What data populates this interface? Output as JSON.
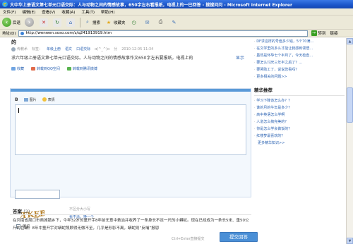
{
  "window": {
    "title": "大中华上册语文第七单元口语交际：人与动物之间的情感故事，650字左右看报纸，电视上的一已回答 - 搜搜问问 - Microsoft Internet Explorer"
  },
  "menu": [
    "文件(F)",
    "编辑(E)",
    "查看(V)",
    "收藏(A)",
    "工具(T)",
    "帮助(H)"
  ],
  "toolbar": {
    "back": "后退",
    "search": "搜索",
    "favorites": "收藏夹"
  },
  "address": {
    "label": "地址(D)",
    "url": "http://wenwen.soso.com/z/q241913919.htm",
    "go": "转到",
    "links": "链接"
  },
  "question": {
    "title": "的",
    "asker": "传教术",
    "tags_prefix": "标签：",
    "tags": [
      "年级上册",
      "语文",
      "口语交际"
    ],
    "level": "ɑ(^_^)ɑ",
    "score": "分",
    "date": "2010-12-05 11:34",
    "body": "求六年级上册语文第七单元口语交际。人与动物之间的情感故事作文650字左右要报纸，电视上的",
    "more": "显示",
    "actions": [
      "收藏",
      "转载到QQ空间",
      "转载到腾讯微博"
    ]
  },
  "editor": {
    "bold": "B",
    "picture": "图片",
    "emoticon": "表情",
    "captcha_text": "TKEB",
    "captcha_hint": "不区分大小写",
    "captcha_refresh": "看不清，换一个",
    "anonymous": "匿名",
    "submit_hint": "Ctrl+Enter直接提交",
    "submit": "提交回答"
  },
  "answers": {
    "label": "答案",
    "count": "(2)",
    "text": "在河南省周口市商城镇乡下，今年32岁的童开宇8年前无意中救治并收养了一条身长不足一尺的小蟒蛇。现在已经成为一条长5米、重50公斤的巨蟒。8年中童开宇对蟒蛇照顾得无微不至，几乎是形影不离，蟒蛇则“反哺”报恩"
  },
  "sidebar": {
    "related": [
      "DF求这样的号值多少钱，5个70满…",
      "在文学里的多么才能让我感到领悟…",
      "虽然是怀孕七个半月了，今天检查…",
      "要怎么讨厌三年半之后了？…",
      "要哭助工了，说说您看吗？",
      "更多相关的问题>>"
    ],
    "recommend_header": "精华推荐",
    "recommend": [
      "学习下降该怎么办？？",
      "谁的月的牛年是多少？",
      "高中英语怎么学啊",
      "人道怎么搞完美的？",
      "你是怎么学会做饭的？",
      "红楼梦最喜欢的？"
    ],
    "recommend_more": "更多精华知识>>"
  },
  "colors": {
    "accent": "#4a8fd6",
    "link": "#2d64b3",
    "titlebar": "#1a55c9"
  }
}
